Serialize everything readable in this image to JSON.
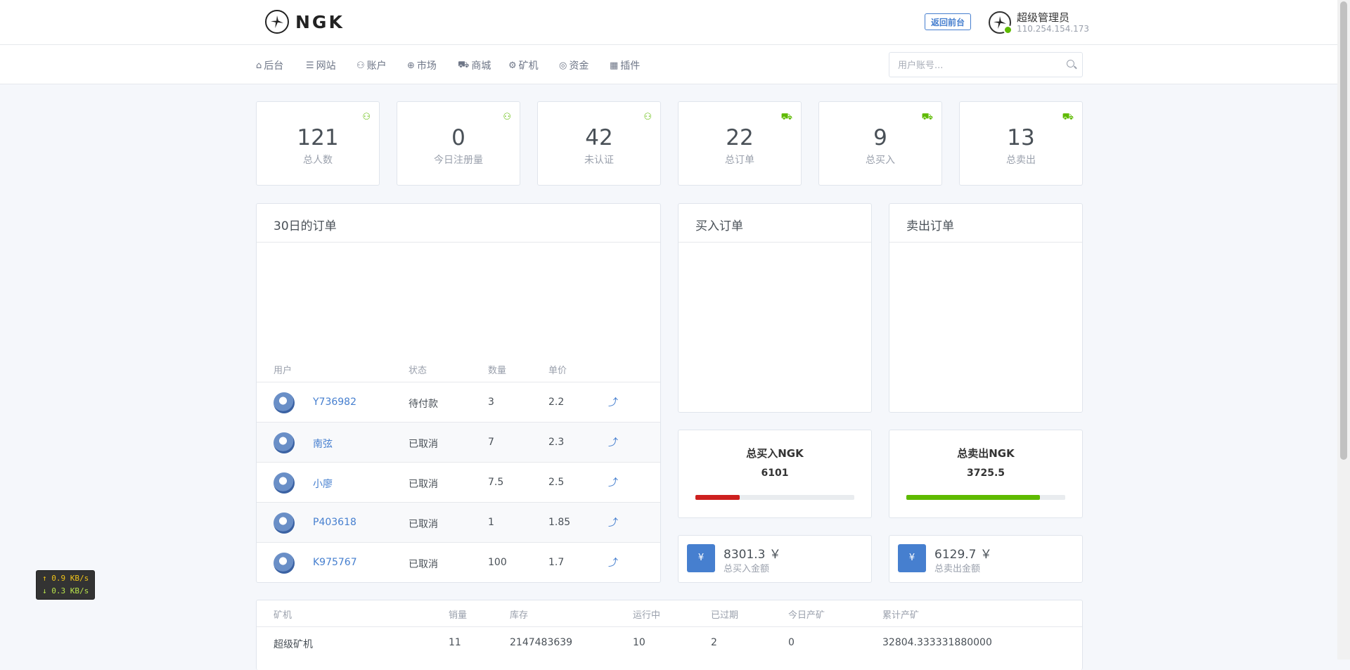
{
  "brand": {
    "logo_text": "NGK"
  },
  "header": {
    "back_button": "返回前台",
    "user_name": "超级管理员",
    "user_ip": "110.254.154.173"
  },
  "nav": {
    "items": [
      {
        "label": "后台",
        "icon": "home-icon"
      },
      {
        "label": "网站",
        "icon": "list-icon"
      },
      {
        "label": "账户",
        "icon": "users-icon"
      },
      {
        "label": "市场",
        "icon": "globe-icon"
      },
      {
        "label": "商城",
        "icon": "cart-icon"
      },
      {
        "label": "矿机",
        "icon": "gear-icon"
      },
      {
        "label": "资金",
        "icon": "money-icon"
      },
      {
        "label": "插件",
        "icon": "grid-icon"
      }
    ],
    "search_placeholder": "用户账号..."
  },
  "stats": [
    {
      "value": "121",
      "label": "总人数",
      "icon": "user-icon"
    },
    {
      "value": "0",
      "label": "今日注册量",
      "icon": "user-icon"
    },
    {
      "value": "42",
      "label": "未认证",
      "icon": "user-icon"
    },
    {
      "value": "22",
      "label": "总订单",
      "icon": "cart-icon"
    },
    {
      "value": "9",
      "label": "总买入",
      "icon": "cart-icon"
    },
    {
      "value": "13",
      "label": "总卖出",
      "icon": "cart-icon"
    }
  ],
  "orders_30d": {
    "title": "30日的订单",
    "columns": [
      "用户",
      "状态",
      "数量",
      "单价"
    ],
    "rows": [
      {
        "user": "Y736982",
        "status": "待付款",
        "qty": "3",
        "price": "2.2"
      },
      {
        "user": "南弦",
        "status": "已取消",
        "qty": "7",
        "price": "2.3"
      },
      {
        "user": "小廖",
        "status": "已取消",
        "qty": "7.5",
        "price": "2.5"
      },
      {
        "user": "P403618",
        "status": "已取消",
        "qty": "1",
        "price": "1.85"
      },
      {
        "user": "K975767",
        "status": "已取消",
        "qty": "100",
        "price": "1.7"
      }
    ]
  },
  "buy_orders": {
    "title": "买入订单"
  },
  "sell_orders": {
    "title": "卖出订单"
  },
  "totals": {
    "buy": {
      "title": "总买入NGK",
      "value": "6101",
      "fill": 0.28,
      "color": "#cd201f"
    },
    "sell": {
      "title": "总卖出NGK",
      "value": "3725.5",
      "fill": 0.84,
      "color": "#5eba00"
    }
  },
  "money": {
    "buy": {
      "symbol": "¥",
      "amount": "8301.3 ￥",
      "label": "总买入金额"
    },
    "sell": {
      "symbol": "¥",
      "amount": "6129.7 ￥",
      "label": "总卖出金额"
    }
  },
  "miners": {
    "columns": [
      "矿机",
      "销量",
      "库存",
      "运行中",
      "已过期",
      "今日产矿",
      "累计产矿"
    ],
    "rows": [
      {
        "name": "超级矿机",
        "sales": "11",
        "stock": "2147483639",
        "running": "10",
        "expired": "2",
        "today": "0",
        "total": "32804.333331880000"
      }
    ]
  },
  "net_widget": {
    "up": "↑ 0.9 KB/s",
    "down": "↓ 0.3 KB/s"
  }
}
